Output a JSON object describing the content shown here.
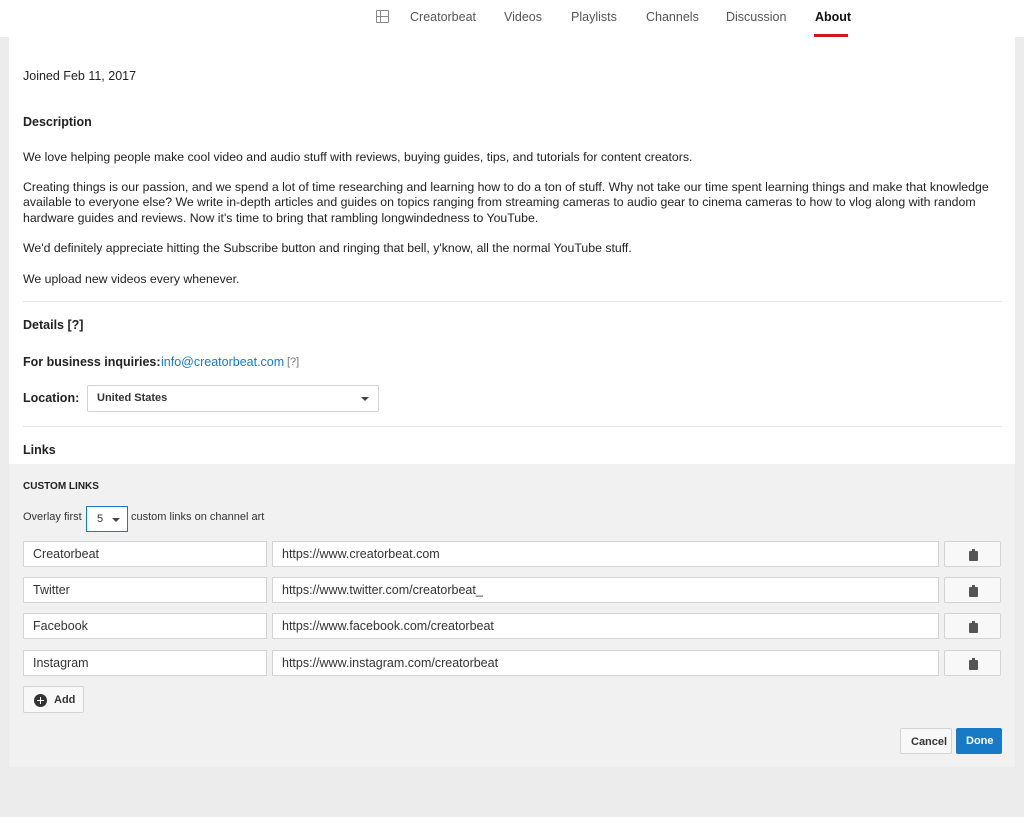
{
  "nav": {
    "icon": "grid-icon",
    "tabs": [
      "Creatorbeat",
      "Videos",
      "Playlists",
      "Channels",
      "Discussion",
      "About"
    ],
    "active_tab": "About",
    "accent_color": "#cc181e"
  },
  "about": {
    "joined": "Joined Feb 11, 2017",
    "description_heading": "Description",
    "description": [
      "We love helping people make cool video and audio stuff with reviews, buying guides, tips, and tutorials for content creators.",
      "Creating things is our passion, and we spend a lot of time researching and learning how to do a ton of stuff. Why not take our time spent learning things and make that knowledge available to everyone else? We write in-depth articles and guides on topics ranging from streaming cameras to audio gear to cinema cameras to how to vlog along with random hardware guides and reviews. Now it's time to bring that rambling longwindedness to YouTube.",
      "We'd definitely appreciate hitting the Subscribe button and ringing that bell, y'know, all the normal YouTube stuff.",
      "We upload new videos every whenever."
    ],
    "details_heading": "Details [?]",
    "business_label": "For business inquiries:",
    "business_email": "info@creatorbeat.com",
    "business_help": "[?]",
    "location_label": "Location:",
    "location_value": "United States",
    "links_heading": "Links"
  },
  "custom_links": {
    "heading": "CUSTOM LINKS",
    "overlay_prefix": "Overlay first",
    "overlay_value": "5",
    "overlay_suffix": "custom links on channel art",
    "items": [
      {
        "name": "Creatorbeat",
        "url": "https://www.creatorbeat.com"
      },
      {
        "name": "Twitter",
        "url": "https://www.twitter.com/creatorbeat_"
      },
      {
        "name": "Facebook",
        "url": "https://www.facebook.com/creatorbeat"
      },
      {
        "name": "Instagram",
        "url": "https://www.instagram.com/creatorbeat"
      }
    ],
    "add_label": "Add",
    "cancel_label": "Cancel",
    "done_label": "Done",
    "primary_color": "#167ac6"
  }
}
